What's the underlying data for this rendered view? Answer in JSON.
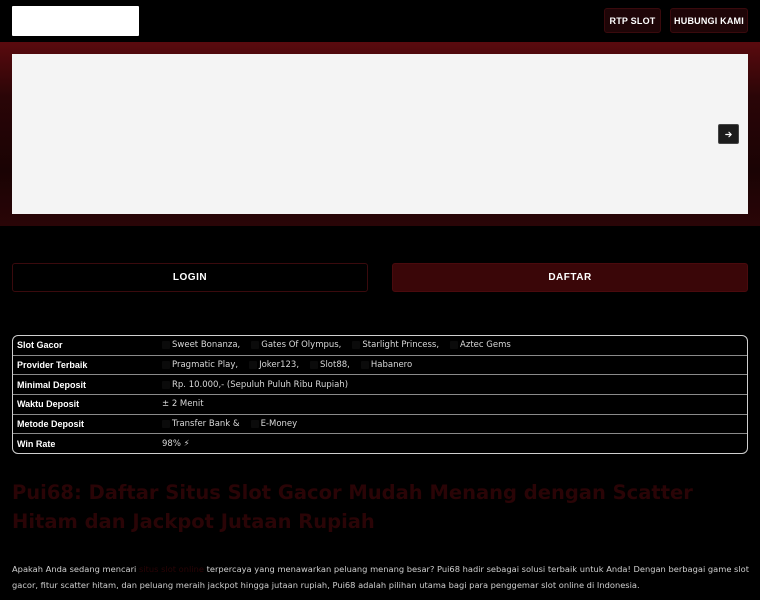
{
  "header": {
    "nav": [
      {
        "label": "RTP SLOT"
      },
      {
        "label": "HUBUNGI KAMI"
      }
    ]
  },
  "slider": {
    "next_icon": "chevron-right-icon"
  },
  "auth": {
    "login_label": "LOGIN",
    "daftar_label": "DAFTAR"
  },
  "info_table": {
    "rows": [
      {
        "label": "Slot Gacor",
        "values": [
          "Sweet Bonanza,",
          "Gates Of Olympus,",
          "Starlight Princess,",
          "Aztec Gems"
        ]
      },
      {
        "label": "Provider Terbaik",
        "values": [
          "Pragmatic Play,",
          "Joker123,",
          "Slot88,",
          "Habanero"
        ]
      },
      {
        "label": "Minimal Deposit",
        "values": [
          "Rp. 10.000,- (Sepuluh Puluh Ribu Rupiah)"
        ]
      },
      {
        "label": "Waktu Deposit",
        "values": [
          "± 2 Menit"
        ]
      },
      {
        "label": "Metode Deposit",
        "values": [
          "Transfer Bank &",
          "E-Money"
        ]
      },
      {
        "label": "Win Rate",
        "values": [
          "98% ⚡"
        ]
      }
    ]
  },
  "article": {
    "heading": "Pui68: Daftar Situs Slot Gacor Mudah Menang dengan Scatter Hitam dan Jackpot Jutaan Rupiah",
    "intro_prefix": "Apakah Anda sedang mencari ",
    "intro_link": "situs slot online",
    "intro_suffix": " terpercaya yang menawarkan peluang menang besar? Pui68 hadir sebagai solusi terbaik untuk Anda! Dengan berbagai game slot gacor, fitur scatter hitam, dan peluang meraih jackpot hingga jutaan rupiah, Pui68 adalah pilihan utama bagi para penggemar slot online di Indonesia."
  }
}
